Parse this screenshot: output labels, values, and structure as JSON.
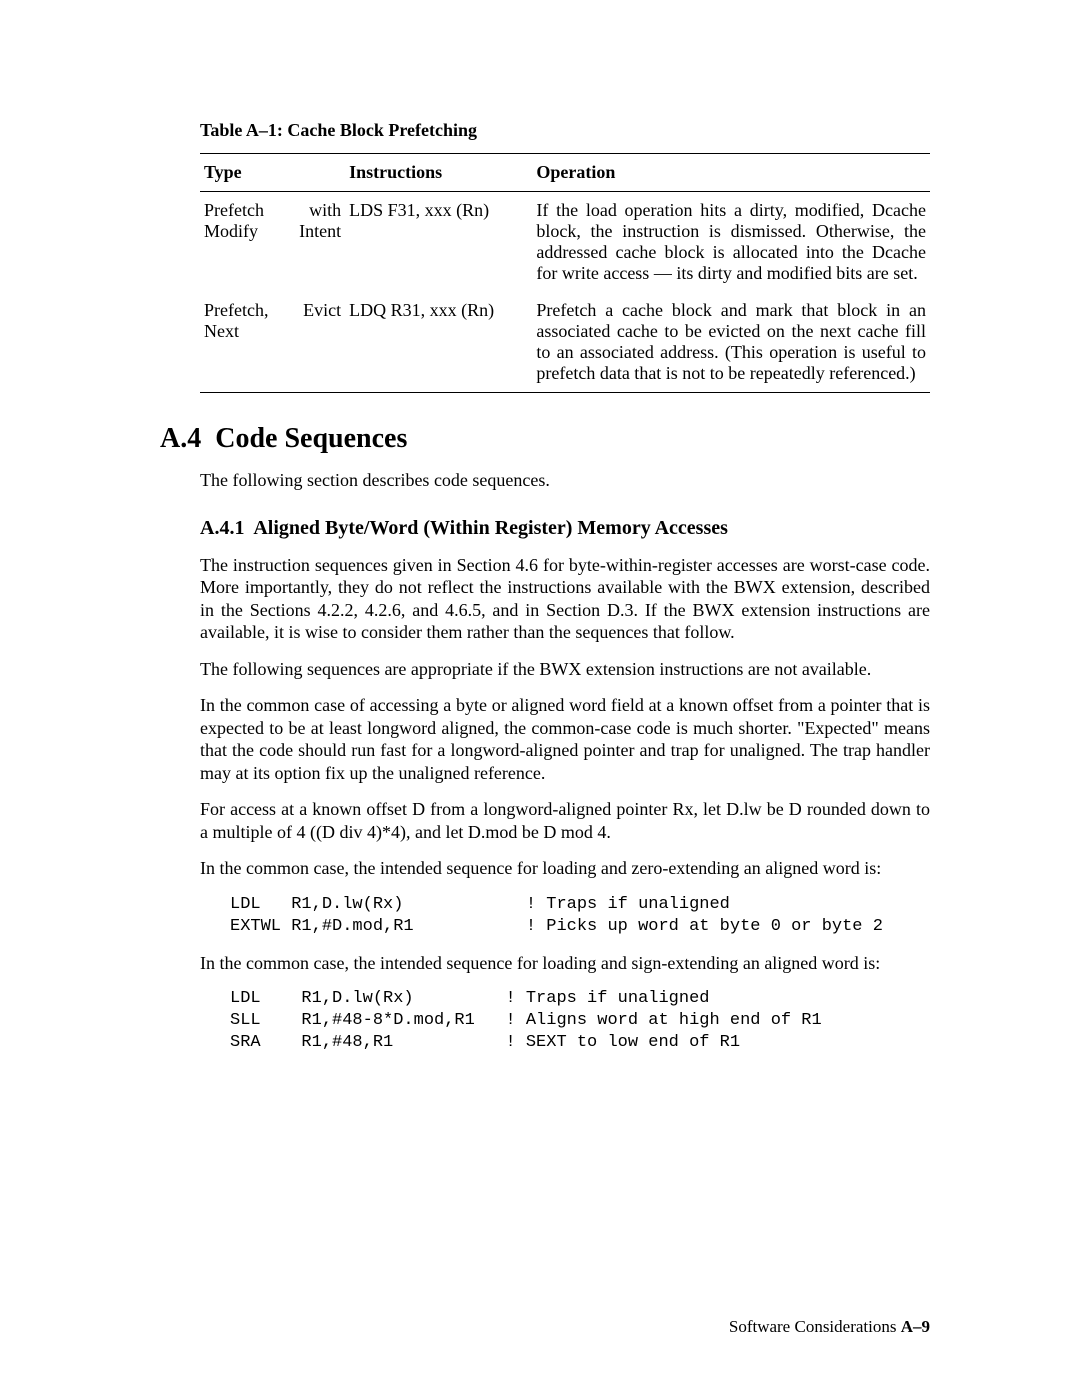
{
  "table": {
    "caption": "Table A–1:  Cache Block Prefetching",
    "headers": {
      "type": "Type",
      "instructions": "Instructions",
      "operation": "Operation"
    },
    "rows": [
      {
        "type": "Prefetch with Modify Intent",
        "instructions": "LDS  F31,  xxx (Rn)",
        "operation": "If the load operation hits a dirty, modified, Dcache block, the instruction is dismissed. Otherwise, the addressed cache block is allocated into the Dcache for write access — its dirty and modified bits are set."
      },
      {
        "type": "Prefetch, Evict Next",
        "instructions": "LDQ  R31, xxx (Rn)",
        "operation": "Prefetch a cache block and mark that block in an associated cache to be evicted on the next cache fill to an associated address. (This operation is useful to prefetch data that is not to be repeatedly referenced.)"
      }
    ]
  },
  "section": {
    "number": "A.4",
    "title": "Code Sequences",
    "intro": "The following section describes code sequences."
  },
  "subsection": {
    "number": "A.4.1",
    "title": "Aligned Byte/Word (Within Register) Memory Accesses",
    "p1": "The instruction sequences given in Section 4.6 for byte-within-register  accesses are worst-case code. More importantly, they do not reflect the instructions available with the BWX extension, described in the Sections 4.2.2, 4.2.6, and 4.6.5, and in Section D.3. If the BWX extension instructions are available, it is wise to consider them rather than the sequences that follow.",
    "p2": "The following sequences are appropriate if the BWX extension instructions are not available.",
    "p3": "In the common case of accessing a byte or aligned word field at a known offset from a pointer that is expected to be at least longword aligned, the common-case code is much shorter. \"Expected\" means that the code should run fast for a longword-aligned pointer and trap for unaligned. The trap handler may at its option fix up the unaligned reference.",
    "p4": "For access at a known offset D from a longword-aligned pointer Rx, let D.lw be D rounded down to a multiple of 4 ((D div 4)*4), and let D.mod be D mod 4.",
    "p5": "In the common case, the intended sequence for loading and zero-extending an aligned word is:",
    "code1": "LDL   R1,D.lw(Rx)            ! Traps if unaligned\nEXTWL R1,#D.mod,R1           ! Picks up word at byte 0 or byte 2",
    "p6": "In the common case, the intended sequence for loading and sign-extending an aligned word is:",
    "code2": "LDL    R1,D.lw(Rx)         ! Traps if unaligned\nSLL    R1,#48-8*D.mod,R1   ! Aligns word at high end of R1\nSRA    R1,#48,R1           ! SEXT to low end of R1"
  },
  "footer": {
    "text": "Software Considerations",
    "page": "A–9"
  }
}
